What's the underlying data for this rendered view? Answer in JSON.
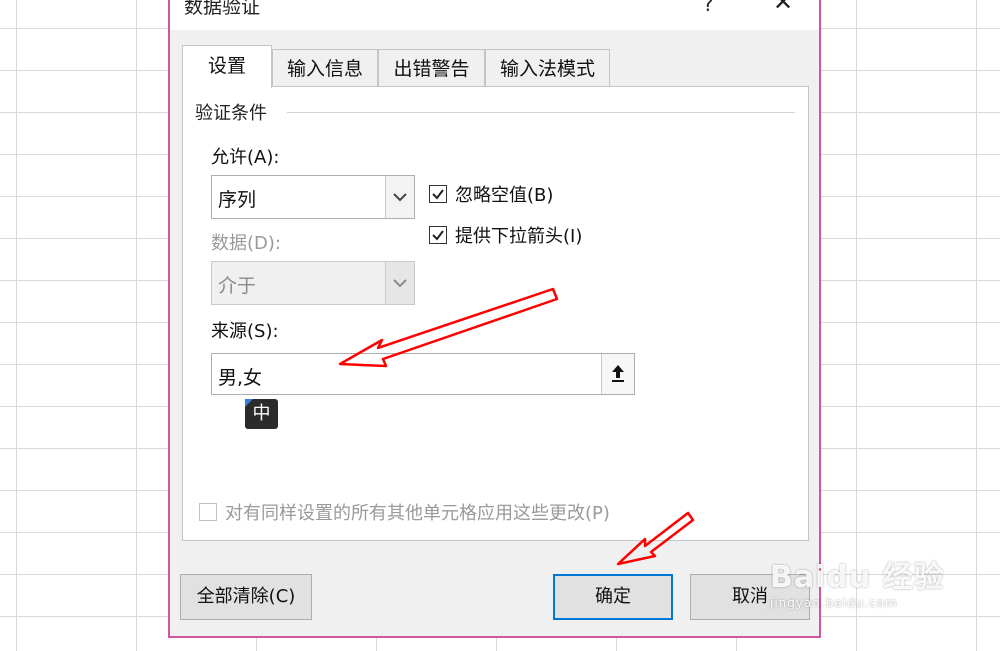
{
  "dialog": {
    "title": "数据验证",
    "help_glyph": "?",
    "close_glyph": "✕",
    "tabs": [
      {
        "label": "设置",
        "active": true
      },
      {
        "label": "输入信息",
        "active": false
      },
      {
        "label": "出错警告",
        "active": false
      },
      {
        "label": "输入法模式",
        "active": false
      }
    ],
    "group_label": "验证条件",
    "allow": {
      "label": "允许(A):",
      "value": "序列"
    },
    "data": {
      "label": "数据(D):",
      "value": "介于"
    },
    "source": {
      "label": "来源(S):",
      "value": "男,女"
    },
    "checkboxes": {
      "ignore_blank": {
        "label": "忽略空值(B)",
        "checked": true
      },
      "dropdown": {
        "label": "提供下拉箭头(I)",
        "checked": true
      },
      "apply_all": {
        "label": "对有同样设置的所有其他单元格应用这些更改(P)",
        "checked": false
      }
    },
    "buttons": {
      "clear_all": "全部清除(C)",
      "ok": "确定",
      "cancel": "取消"
    }
  },
  "ime_indicator": "中",
  "watermark": {
    "logo": "Baidu 经验",
    "url": "jingyan.baidu.com"
  },
  "colors": {
    "dialog_border": "#d0569f",
    "annotation_arrow": "#ff0000",
    "primary_focus": "#0078d7"
  }
}
